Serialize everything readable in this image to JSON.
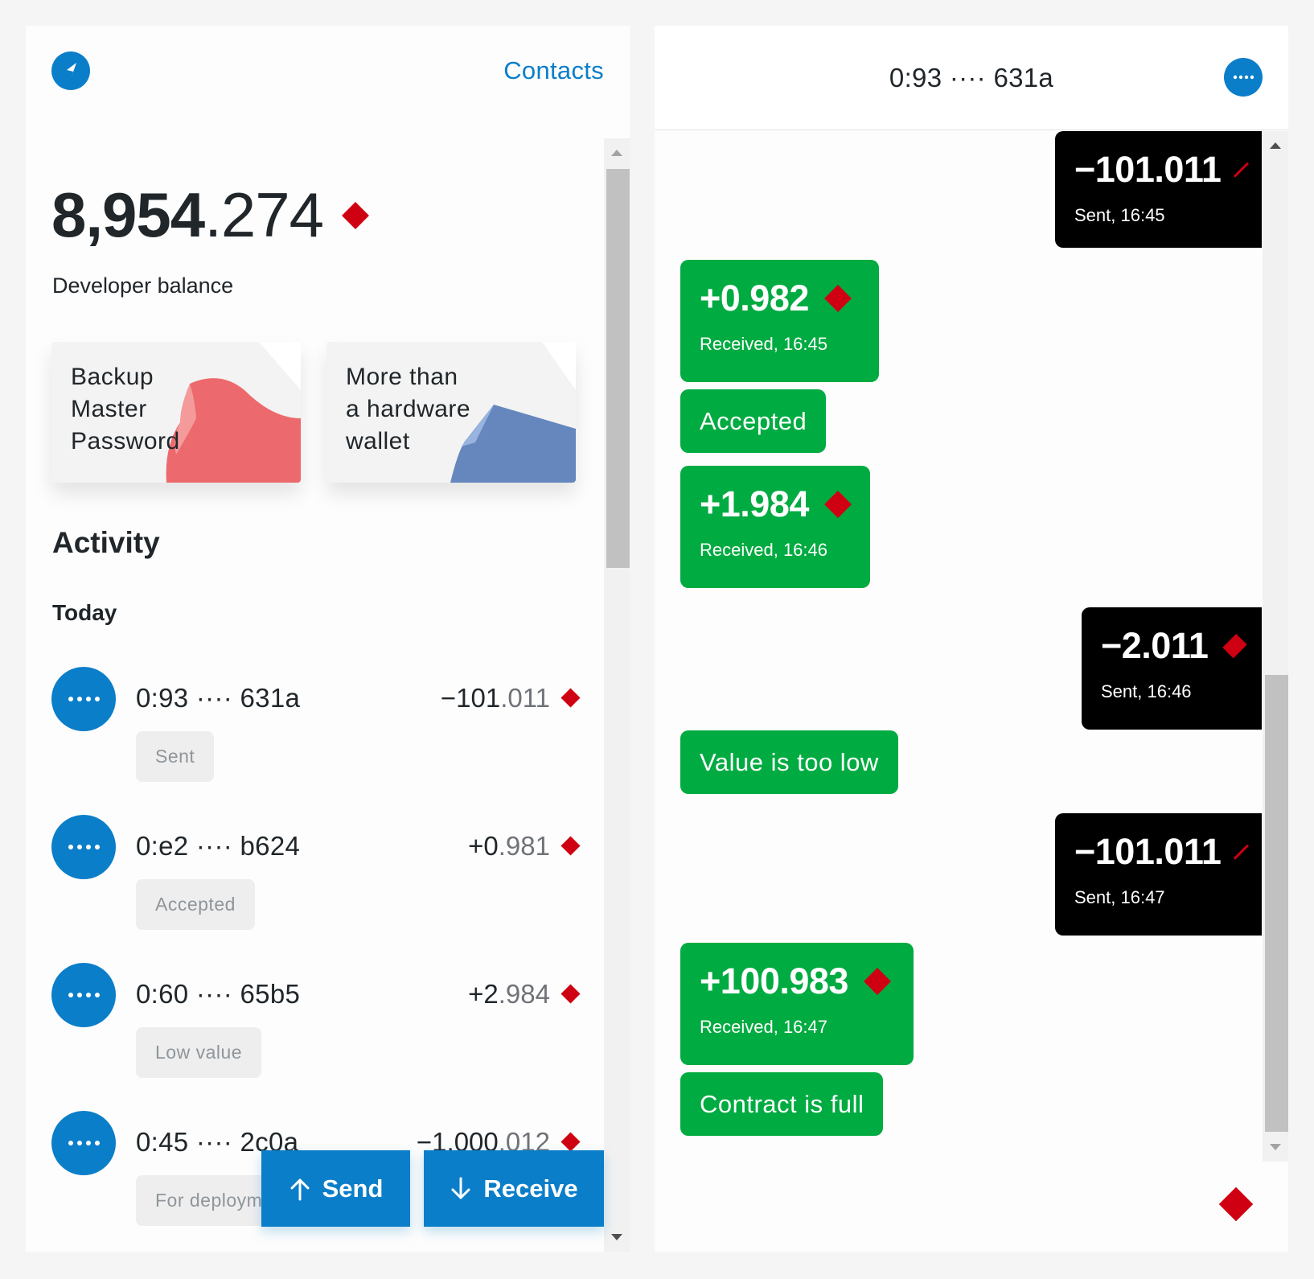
{
  "colors": {
    "accent": "#0b7ec9",
    "crystal": "#cf0011",
    "sent_bubble": "#000000",
    "received_bubble": "#00ab41",
    "tag_background": "#eeeeee"
  },
  "wallet": {
    "contacts_link": "Contacts",
    "balance": {
      "integer": "8,954",
      "fraction": ".274",
      "label": "Developer balance"
    },
    "cards": [
      {
        "text_lines": [
          "Backup",
          "Master",
          "Password"
        ],
        "art_color": "#ec6a6d"
      },
      {
        "text_lines": [
          "More than",
          "a hardware",
          "wallet"
        ],
        "art_color": "#6587bd"
      }
    ],
    "activity_title": "Activity",
    "section_label": "Today",
    "transactions": [
      {
        "address": "0:93 ···· 631a",
        "amount_main": "−101",
        "amount_frac": ".011",
        "tag": "Sent"
      },
      {
        "address": "0:e2 ···· b624",
        "amount_main": "+0",
        "amount_frac": ".981",
        "tag": "Accepted"
      },
      {
        "address": "0:60 ···· 65b5",
        "amount_main": "+2",
        "amount_frac": ".984",
        "tag": "Low value"
      },
      {
        "address": "0:45 ···· 2c0a",
        "amount_main": "−1,000",
        "amount_frac": ".012",
        "tag": "For deployment"
      }
    ],
    "send_button": "Send",
    "receive_button": "Receive"
  },
  "chat": {
    "title": "0:93 ···· 631a",
    "messages": [
      {
        "kind": "sent",
        "amount": "−101.011",
        "meta": "Sent, 16:45"
      },
      {
        "kind": "received",
        "amount": "+0.982",
        "meta": "Received, 16:45"
      },
      {
        "kind": "status",
        "text": "Accepted"
      },
      {
        "kind": "received",
        "amount": "+1.984",
        "meta": "Received, 16:46"
      },
      {
        "kind": "sent",
        "amount": "−2.011",
        "meta": "Sent, 16:46"
      },
      {
        "kind": "status",
        "text": "Value is too low"
      },
      {
        "kind": "sent",
        "amount": "−101.011",
        "meta": "Sent, 16:47"
      },
      {
        "kind": "received",
        "amount": "+100.983",
        "meta": "Received, 16:47"
      },
      {
        "kind": "status",
        "text": "Contract is full"
      }
    ]
  }
}
